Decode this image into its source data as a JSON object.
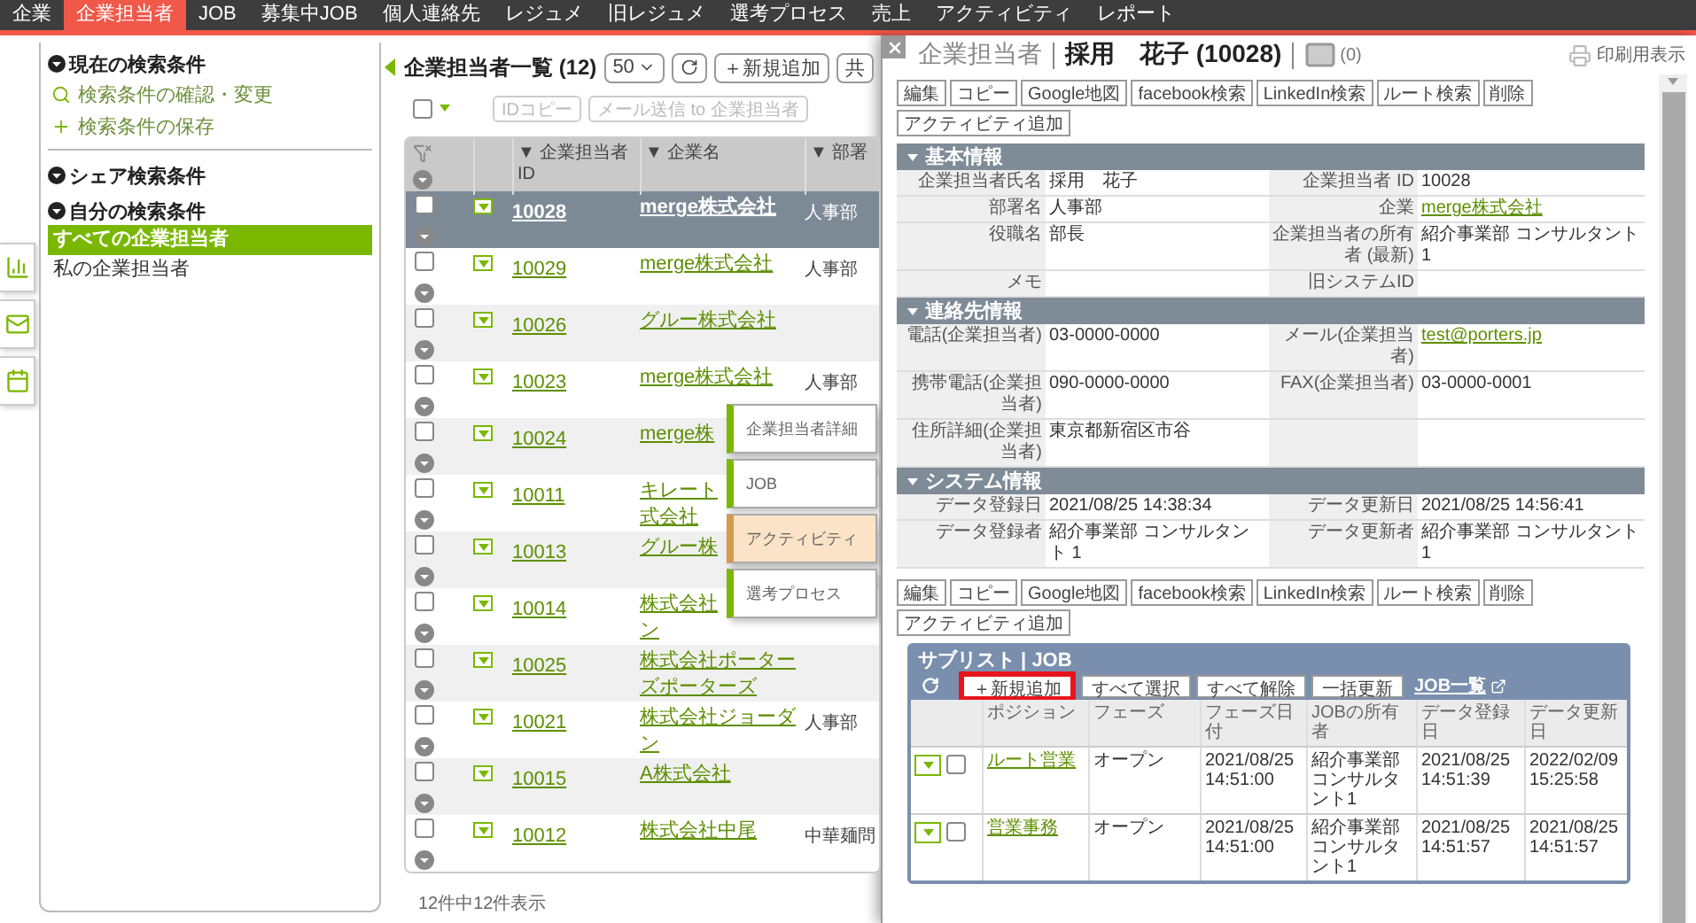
{
  "nav": {
    "items": [
      {
        "label": "企業",
        "selected": false
      },
      {
        "label": "企業担当者",
        "selected": true
      },
      {
        "label": "JOB",
        "selected": false
      },
      {
        "label": "募集中JOB",
        "selected": false
      },
      {
        "label": "個人連絡先",
        "selected": false
      },
      {
        "label": "レジュメ",
        "selected": false
      },
      {
        "label": "旧レジュメ",
        "selected": false
      },
      {
        "label": "選考プロセス",
        "selected": false
      },
      {
        "label": "売上",
        "selected": false
      },
      {
        "label": "アクティビティ",
        "selected": false
      },
      {
        "label": "レポート",
        "selected": false
      }
    ]
  },
  "sidebar": {
    "current": {
      "title": "現在の検索条件",
      "actions": [
        {
          "kind": "search",
          "label": "検索条件の確認・変更"
        },
        {
          "kind": "add",
          "label": "検索条件の保存"
        }
      ]
    },
    "shared": {
      "title": "シェア検索条件"
    },
    "mine": {
      "title": "自分の検索条件",
      "items": [
        {
          "label": "すべての企業担当者",
          "selected": true
        },
        {
          "label": "私の企業担当者",
          "selected": false
        }
      ]
    }
  },
  "list": {
    "title": "企業担当者一覧 (12)",
    "page_size": "50",
    "toolbar_buttons": [
      "＋新規追加",
      "共"
    ],
    "select_all": {
      "checked": false
    },
    "bulk_buttons": [
      {
        "label": "IDコピー",
        "disabled": true
      },
      {
        "label": "メール送信 to 企業担当者",
        "disabled": true
      }
    ],
    "columns": [
      "▼ 企業担当者 ID",
      "▼ 企業名",
      "▼ 部署"
    ],
    "rows": [
      {
        "id": "10028",
        "company_lines": [
          "merge株式会社"
        ],
        "department": "人事部",
        "selected": true
      },
      {
        "id": "10029",
        "company_lines": [
          "merge株式会社"
        ],
        "department": "人事部",
        "selected": false
      },
      {
        "id": "10026",
        "company_lines": [
          "グルー株式会社"
        ],
        "selected": false
      },
      {
        "id": "10023",
        "company_lines": [
          "merge株式会社"
        ],
        "department": "人事部",
        "selected": false
      },
      {
        "id": "10024",
        "company_lines": [
          "merge株"
        ],
        "selected": false
      },
      {
        "id": "10011",
        "company_lines": [
          "キレート",
          "式会社"
        ],
        "selected": false
      },
      {
        "id": "10013",
        "company_lines": [
          "グルー株"
        ],
        "selected": false
      },
      {
        "id": "10014",
        "company_lines": [
          "株式会社",
          "ン"
        ],
        "selected": false
      },
      {
        "id": "10025",
        "company_lines": [
          "株式会社ポーター",
          "ズポーターズ"
        ],
        "selected": false
      },
      {
        "id": "10021",
        "company_lines": [
          "株式会社ジョーダ",
          "ン"
        ],
        "department": "人事部",
        "selected": false
      },
      {
        "id": "10015",
        "company_lines": [
          "A株式会社"
        ],
        "selected": false
      },
      {
        "id": "10012",
        "company_lines": [
          "株式会社中尾"
        ],
        "department": "中華麺問",
        "selected": false
      }
    ],
    "footer": "12件中12件表示"
  },
  "context_menu": {
    "items": [
      {
        "label": "企業担当者詳細",
        "selected": false
      },
      {
        "label": "JOB",
        "selected": false
      },
      {
        "label": "アクティビティ",
        "selected": true
      },
      {
        "label": "選考プロセス",
        "selected": false
      }
    ]
  },
  "detail": {
    "entity": "企業担当者",
    "name": "採用　花子 (10028)",
    "mail_count": "(0)",
    "print": "印刷用表示",
    "top_buttons": [
      "編集",
      "コピー",
      "Google地図",
      "facebook検索",
      "LinkedIn検索",
      "ルート検索",
      "削除",
      "アクティビティ追加"
    ],
    "sections": [
      {
        "title": "基本情報",
        "expanded": true,
        "rows": [
          {
            "cells": [
              {
                "label": "企業担当者氏名",
                "value": "採用　花子"
              },
              {
                "label": "企業担当者 ID",
                "value": "10028"
              }
            ]
          },
          {
            "cells": [
              {
                "label": "部署名",
                "value": "人事部"
              },
              {
                "label": "企業",
                "value": "merge株式会社",
                "kind": "link"
              }
            ]
          },
          {
            "cells": [
              {
                "label": "役職名",
                "value": "部長"
              },
              {
                "label": "企業担当者の所有者 (最新)",
                "value": "紹介事業部 コンサルタント 1"
              }
            ]
          },
          {
            "cells": [
              {
                "label": "メモ"
              },
              {
                "label": "旧システムID"
              }
            ]
          }
        ]
      },
      {
        "title": "連絡先情報",
        "expanded": true,
        "rows": [
          {
            "cells": [
              {
                "label": "電話(企業担当者)",
                "value": "03-0000-0000"
              },
              {
                "label": "メール(企業担当者)",
                "value": "test@porters.jp",
                "kind": "link"
              }
            ]
          },
          {
            "cells": [
              {
                "label": "携帯電話(企業担当者)",
                "value": "090-0000-0000"
              },
              {
                "label": "FAX(企業担当者)",
                "value": "03-0000-0001"
              }
            ]
          },
          {
            "cells": [
              {
                "label": "住所詳細(企業担当者)",
                "value": "東京都新宿区市谷"
              },
              {}
            ]
          }
        ]
      },
      {
        "title": "システム情報",
        "expanded": true,
        "rows": [
          {
            "cells": [
              {
                "label": "データ登録日",
                "value": "2021/08/25 14:38:34"
              },
              {
                "label": "データ更新日",
                "value": "2021/08/25 14:56:41"
              }
            ]
          },
          {
            "cells": [
              {
                "label": "データ登録者",
                "value": "紹介事業部 コンサルタント 1"
              },
              {
                "label": "データ更新者",
                "value": "紹介事業部 コンサルタント 1"
              }
            ]
          }
        ]
      }
    ],
    "bottom_buttons": [
      "編集",
      "コピー",
      "Google地図",
      "facebook検索",
      "LinkedIn検索",
      "ルート検索",
      "削除",
      "アクティビティ追加"
    ],
    "sublist": {
      "title": "サブリスト | JOB",
      "buttons": [
        {
          "label": "＋新規追加",
          "highlighted": true
        },
        {
          "label": "すべて選択",
          "highlighted": false
        },
        {
          "label": "すべて解除",
          "highlighted": false
        },
        {
          "label": "一括更新",
          "highlighted": false
        }
      ],
      "link": "JOB一覧",
      "columns": [
        "ポジション",
        "フェーズ",
        "フェーズ日付",
        "JOBの所有者",
        "データ登録日",
        "データ更新日"
      ],
      "rows": [
        {
          "position": "ルート営業",
          "phase": "オープン",
          "phase_date": "2021/08/25 14:51:00",
          "owner": "紹介事業部コンサルタント1",
          "created": "2021/08/25 14:51:39",
          "updated": "2022/02/09 15:25:58",
          "checked": false
        },
        {
          "position": "営業事務",
          "phase": "オープン",
          "phase_date": "2021/08/25 14:51:00",
          "owner": "紹介事業部コンサルタント1",
          "created": "2021/08/25 14:51:57",
          "updated": "2021/08/25 14:51:57",
          "checked": false
        }
      ]
    }
  }
}
